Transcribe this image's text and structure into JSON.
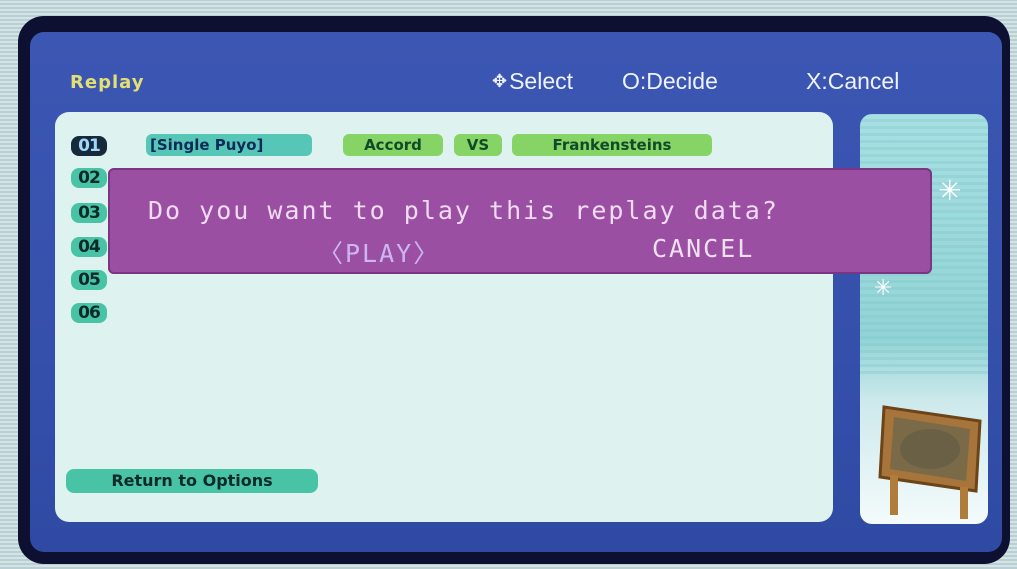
{
  "header": {
    "title": "Replay",
    "hints": {
      "select": "Select",
      "decide": "O:Decide",
      "cancel": "X:Cancel"
    }
  },
  "slots": [
    "01",
    "02",
    "03",
    "04",
    "05",
    "06"
  ],
  "selected_slot_index": 0,
  "entry": {
    "mode": "[Single Puyo]",
    "player1": "Accord",
    "vs": "VS",
    "player2": "Frankensteins"
  },
  "return_label": "Return to Options",
  "dialog": {
    "message": "Do you want to play this replay data?",
    "play_label": "〈PLAY〉",
    "cancel_label": "CANCEL"
  },
  "colors": {
    "panel": "#3c57b3",
    "dialog": "#9b4fa2",
    "title": "#e3df72",
    "list_bg": "#def3ef"
  },
  "icons": {
    "select": "dpad-icon",
    "snow": "snowflake-icon"
  }
}
